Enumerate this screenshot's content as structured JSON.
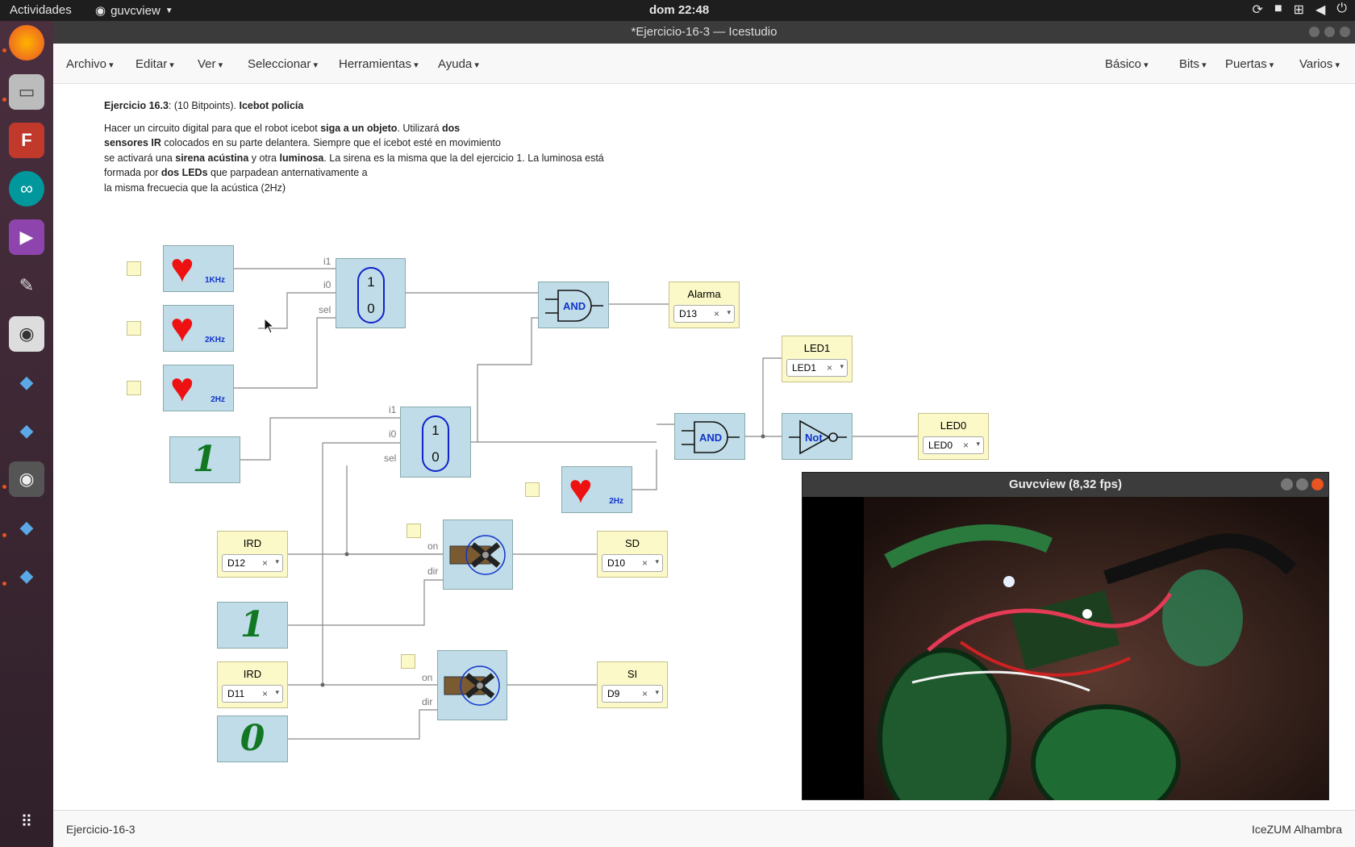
{
  "topbar": {
    "activities": "Actividades",
    "app": "guvcview",
    "clock": "dom 22:48"
  },
  "window": {
    "title": "*Ejercicio-16-3 — Icestudio"
  },
  "menu": {
    "left": [
      "Archivo",
      "Editar",
      "Ver",
      "Seleccionar",
      "Herramientas",
      "Ayuda"
    ],
    "right": [
      "Básico",
      "Bits",
      "Puertas",
      "Varios"
    ]
  },
  "description": {
    "title_bold": "Ejercicio 16.3",
    "title_mid": ": (10 Bitpoints). ",
    "title_bold2": "Icebot policía",
    "lines": [
      [
        "Hacer un circuito digital para que el robot icebot ",
        "siga a un objeto",
        ". Utilizará ",
        "dos",
        ""
      ],
      [
        "",
        "sensores IR",
        " colocados en su parte delantera. Siempre que el icebot esté en movimiento",
        "",
        ""
      ],
      [
        "se activará una ",
        "sirena acústina",
        " y otra ",
        "luminosa",
        ". La sirena es la misma que la del ejercicio 1. La luminosa está"
      ],
      [
        "formada por ",
        "dos LEDs",
        " que parpadean anternativamente a",
        "",
        ""
      ],
      [
        "la misma frecuecia que la acústica (2Hz)",
        "",
        "",
        "",
        ""
      ]
    ]
  },
  "blocks": {
    "hearts": [
      "1KHz",
      "2KHz",
      "2Hz",
      "2Hz"
    ],
    "mux_labels": {
      "i1": "i1",
      "i0": "i0",
      "sel": "sel",
      "one": "1",
      "zero": "0"
    },
    "gates": {
      "and": "AND",
      "not": "Not"
    },
    "servo_ports": {
      "on": "on",
      "dir": "dir"
    },
    "consts": [
      "1",
      "1",
      "0"
    ],
    "io": [
      {
        "name": "Alarma",
        "pin": "D13"
      },
      {
        "name": "LED1",
        "pin": "LED1"
      },
      {
        "name": "LED0",
        "pin": "LED0"
      },
      {
        "name": "IRD",
        "pin": "D12"
      },
      {
        "name": "SD",
        "pin": "D10"
      },
      {
        "name": "IRD",
        "pin": "D11"
      },
      {
        "name": "SI",
        "pin": "D9"
      }
    ],
    "remove_glyph": "×",
    "caret_glyph": "▾"
  },
  "guvcview": {
    "title": "Guvcview  (8,32 fps)"
  },
  "status": {
    "left": "Ejercicio-16-3",
    "right": "IceZUM Alhambra"
  },
  "colors": {
    "block": "#bfdce8",
    "io": "#fbf9c8",
    "accent": "#e95420",
    "gate_text": "#1133cc"
  }
}
